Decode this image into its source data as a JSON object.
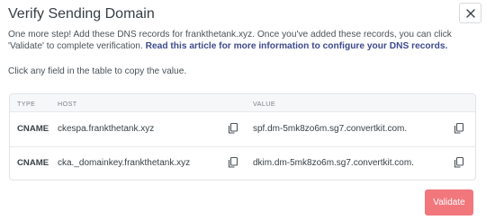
{
  "modal": {
    "title": "Verify Sending Domain",
    "description_text": "One more step! Add these DNS records for frankthetank.xyz. Once you've added these records, you can click 'Validate' to complete verification.",
    "description_link": "Read this article for more information to configure your DNS records.",
    "hint": "Click any field in the table to copy the value."
  },
  "table": {
    "headers": {
      "type": "TYPE",
      "host": "HOST",
      "value": "VALUE"
    },
    "rows": [
      {
        "type": "CNAME",
        "host": "ckespa.frankthetank.xyz",
        "value": "spf.dm-5mk8zo6m.sg7.convertkit.com."
      },
      {
        "type": "CNAME",
        "host": "cka._domainkey.frankthetank.xyz",
        "value": "dkim.dm-5mk8zo6m.sg7.convertkit.com."
      }
    ]
  },
  "actions": {
    "validate_label": "Validate"
  },
  "icons": {
    "close": "close-icon",
    "copy": "copy-icon"
  },
  "colors": {
    "validate_bg": "#f2777d",
    "link": "#3e4a8c"
  }
}
